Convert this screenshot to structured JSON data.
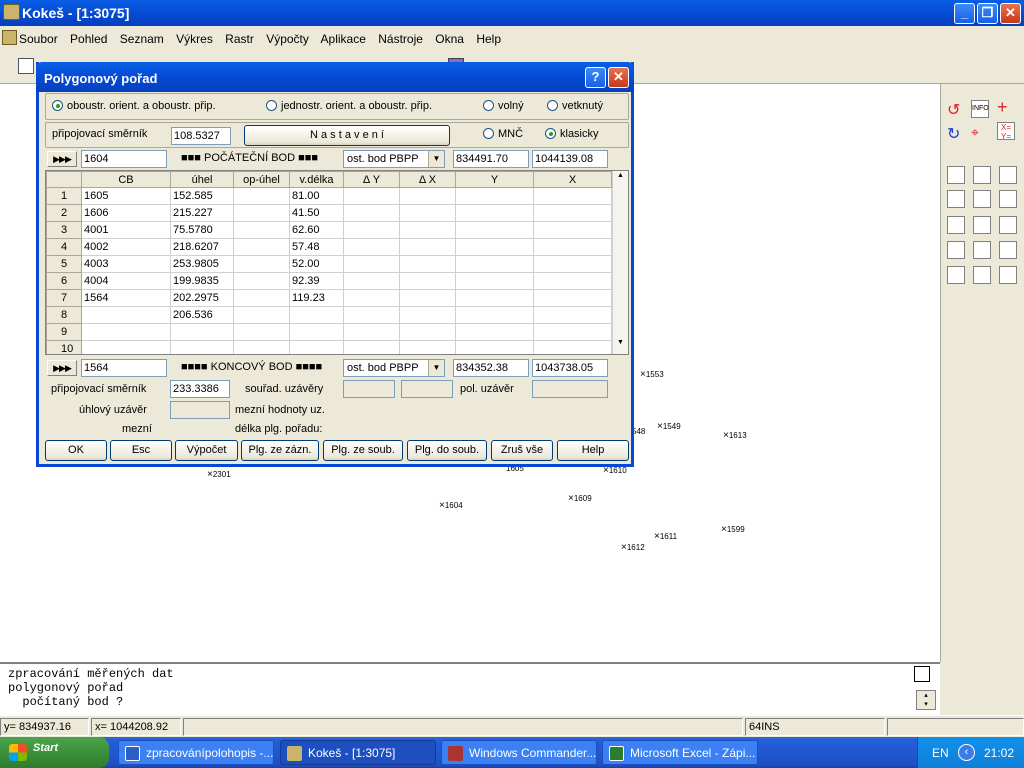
{
  "window": {
    "title": "Kokeš - [1:3075]",
    "min": "_",
    "max": "❐",
    "close": "✕"
  },
  "menu": [
    "Soubor",
    "Pohled",
    "Seznam",
    "Výkres",
    "Rastr",
    "Výpočty",
    "Aplikace",
    "Nástroje",
    "Okna",
    "Help"
  ],
  "canvas_points": [
    {
      "label": "1553"
    },
    {
      "label": "548"
    },
    {
      "label": "1549"
    },
    {
      "label": "1613"
    },
    {
      "label": "1605"
    },
    {
      "label": "1610"
    },
    {
      "label": "2301"
    },
    {
      "label": "1609"
    },
    {
      "label": "1604"
    },
    {
      "label": "1611"
    },
    {
      "label": "1599"
    },
    {
      "label": "1612"
    }
  ],
  "dialog": {
    "title": "Polygonový pořad",
    "help_btn": "?",
    "close_btn": "✕",
    "orient": {
      "opt1": "oboustr. orient. a oboustr. přip.",
      "opt2": "jednostr. orient. a oboustr. přip.",
      "opt3": "volný",
      "opt4": "vetknutý"
    },
    "smernik_label": "připojovací směrník",
    "smernik_value": "108.5327",
    "nastaveni": "N a s t a v e n í",
    "mnc": "MNČ",
    "klasicky": "klasicky",
    "start": {
      "arrow": "▶▶▶",
      "cb": "1604",
      "label": "■■■ POČÁTEČNÍ BOD ■■■",
      "type": "ost. bod PBPP",
      "y": "834491.70",
      "x": "1044139.08"
    },
    "columns": [
      "",
      "CB",
      "úhel",
      "op-úhel",
      "v.délka",
      "Δ Y",
      "Δ X",
      "Y",
      "X"
    ],
    "rows": [
      {
        "n": "1",
        "cb": "1605",
        "uhel": "152.585",
        "op": "",
        "vd": "81.00"
      },
      {
        "n": "2",
        "cb": "1606",
        "uhel": "215.227",
        "op": "",
        "vd": "41.50"
      },
      {
        "n": "3",
        "cb": "4001",
        "uhel": "75.5780",
        "op": "",
        "vd": "62.60"
      },
      {
        "n": "4",
        "cb": "4002",
        "uhel": "218.6207",
        "op": "",
        "vd": "57.48"
      },
      {
        "n": "5",
        "cb": "4003",
        "uhel": "253.9805",
        "op": "",
        "vd": "52.00"
      },
      {
        "n": "6",
        "cb": "4004",
        "uhel": "199.9835",
        "op": "",
        "vd": "92.39"
      },
      {
        "n": "7",
        "cb": "1564",
        "uhel": "202.2975",
        "op": "",
        "vd": "119.23"
      },
      {
        "n": "8",
        "cb": "",
        "uhel": "206.536",
        "op": "",
        "vd": ""
      },
      {
        "n": "9",
        "cb": "",
        "uhel": "",
        "op": "",
        "vd": ""
      },
      {
        "n": "10",
        "cb": "",
        "uhel": "",
        "op": "",
        "vd": ""
      }
    ],
    "end": {
      "arrow": "▶▶▶",
      "cb": "1564",
      "label": "■■■■ KONCOVÝ BOD ■■■■",
      "type": "ost. bod PBPP",
      "y": "834352.38",
      "x": "1043738.05"
    },
    "end_smernik_label": "připojovací směrník",
    "end_smernik_value": "233.3386",
    "sour_uzavery": "souřad. uzávěry",
    "pol_uzaver": "pol. uzávěr",
    "uhlovy_uzaver": "úhlový uzávěr",
    "mezni_hodnoty": "mezní hodnoty uz.",
    "mezni": "mezní",
    "delka": "délka plg. pořadu:",
    "buttons": [
      "OK",
      "Esc",
      "Výpočet",
      "Plg. ze zázn.",
      "Plg. ze soub.",
      "Plg. do soub.",
      "Zruš vše",
      "Help"
    ]
  },
  "console": {
    "line1": "zpracování měřených dat",
    "line2": "polygonový pořad",
    "line3": "  počítaný bod ?"
  },
  "status": {
    "y": "y=  834937.16",
    "x": "x= 1044208.92",
    "mode": "64INS"
  },
  "taskbar": {
    "start": "Start",
    "tasks": [
      "zpracovánípolohopis -...",
      "Kokeš - [1:3075]",
      "Windows Commander...",
      "Microsoft Excel - Zápi..."
    ],
    "lang": "EN",
    "time": "21:02"
  },
  "colors": {
    "titlebar": "#0649d3",
    "taskbar": "#245edb",
    "start": "#3b913b",
    "dialog_bg": "#ece9d8"
  }
}
